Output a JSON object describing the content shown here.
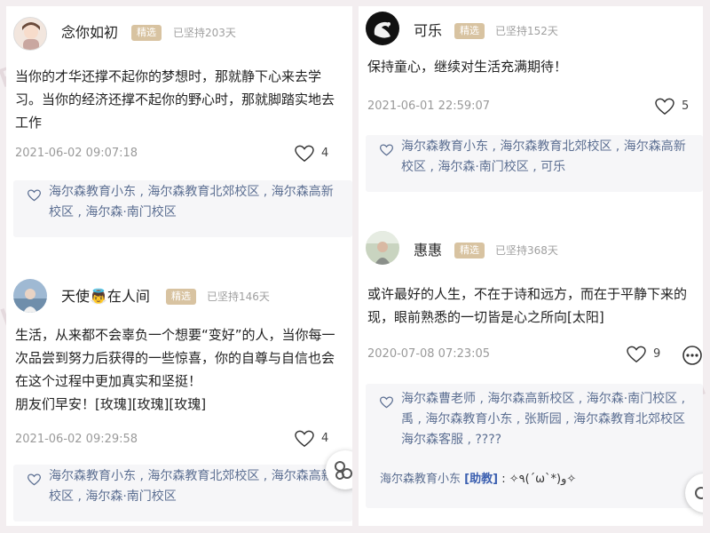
{
  "colors": {
    "badge_bg": "#d8c3a1",
    "liker_link": "#5c6f92",
    "reply_tag": "#3b5fb0",
    "page_bg": "#f3eef0"
  },
  "icons": {
    "heart": "heart-outline-icon",
    "more": "more-dots-icon",
    "float": "floating-action-icon"
  },
  "left_panel": {
    "posts": [
      {
        "username": "念你如初",
        "badge": "精选",
        "streak": "已坚持203天",
        "content_lines": [
          "当你的才华还撑不起你的梦想时，那就静下心来去学",
          "习。当你的经济还撑不起你的野心时，那就脚踏实地去",
          "工作"
        ],
        "timestamp": "2021-06-02 09:07:18",
        "likes": "4",
        "likers_lines": [
          "海尔森教育小东 , 海尔森教育北郊校区 , 海尔森高新",
          "校区 , 海尔森·南门校区"
        ]
      },
      {
        "username": "天使👼在人间",
        "badge": "精选",
        "streak": "已坚持146天",
        "content_lines": [
          "生活，从来都不会辜负一个想要“变好”的人，当你每一",
          "次品尝到努力后获得的一些惊喜，你的自尊与自信也会",
          "在这个过程中更加真实和坚挺！",
          "朋友们早安！[玫瑰][玫瑰][玫瑰]"
        ],
        "timestamp": "2021-06-02 09:29:58",
        "likes": "4",
        "likers_lines": [
          "海尔森教育小东 , 海尔森教育北郊校区 , 海尔森高新",
          "校区 , 海尔森·南门校区"
        ]
      }
    ]
  },
  "right_panel": {
    "posts": [
      {
        "username": "可乐",
        "badge": "精选",
        "streak": "已坚持152天",
        "content_lines": [
          "保持童心，继续对生活充满期待！"
        ],
        "timestamp": "2021-06-01 22:59:07",
        "likes": "5",
        "likers_lines": [
          "海尔森教育小东 , 海尔森教育北郊校区 , 海尔森高新",
          "校区 , 海尔森·南门校区 , 可乐"
        ]
      },
      {
        "username": "惠惠",
        "badge": "精选",
        "streak": "已坚持368天",
        "content_lines": [
          "或许最好的人生，不在于诗和远方，而在于平静下来的",
          "现，眼前熟悉的一切皆是心之所向[太阳]"
        ],
        "timestamp": "2020-07-08 07:23:05",
        "likes": "9",
        "likers_lines": [
          "海尔森曹老师 , 海尔森高新校区 , 海尔森·南门校区 ,",
          "禹 , 海尔森教育小东 , 张斯园 , 海尔森教育北郊校区",
          "海尔森客服 , ????"
        ],
        "reply": {
          "author": "海尔森教育小东",
          "tag": "[助教]",
          "separator": " : ",
          "text": "✧٩(ˊωˋ*)و✧"
        }
      }
    ]
  }
}
